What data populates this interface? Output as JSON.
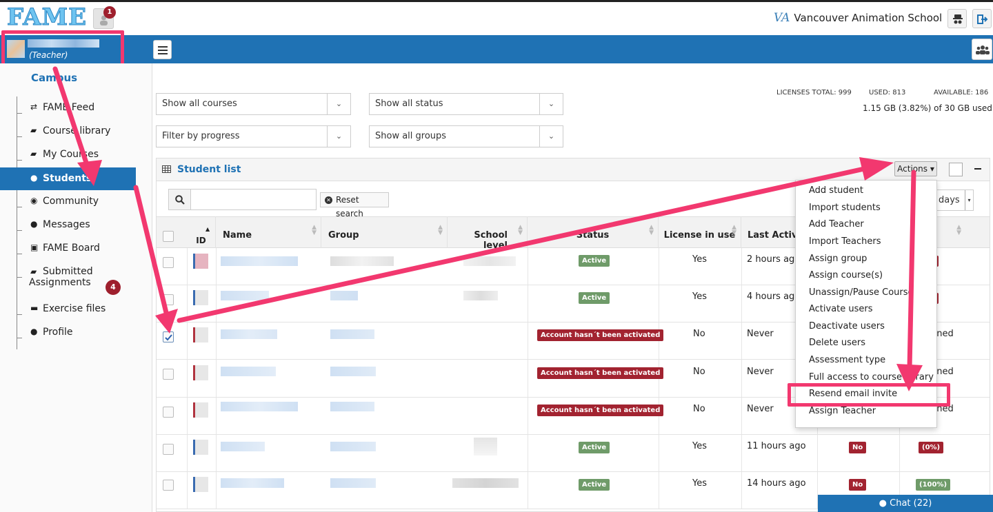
{
  "app": {
    "logo": "FAME",
    "notifications_count": "1",
    "school_name": "Vancouver Animation School",
    "school_logo": "VA"
  },
  "user": {
    "role": "(Teacher)"
  },
  "sidebar": {
    "section": "Campus",
    "items": [
      {
        "label": "FAME Feed",
        "icon": "retweet-icon"
      },
      {
        "label": "Course library",
        "icon": "book-icon"
      },
      {
        "label": "My Courses",
        "icon": "book-icon"
      },
      {
        "label": "Students",
        "icon": "users-icon",
        "active": true
      },
      {
        "label": "Community",
        "icon": "globe-icon"
      },
      {
        "label": "Messages",
        "icon": "comment-icon"
      },
      {
        "label": "FAME Board",
        "icon": "image-icon"
      },
      {
        "label": "Submitted",
        "label2": "Assignments",
        "icon": "book-icon",
        "badge": "4"
      },
      {
        "label": "Exercise files",
        "icon": "folder-open-icon"
      },
      {
        "label": "Profile",
        "icon": "user-icon"
      }
    ]
  },
  "filters": {
    "courses": "Show all courses",
    "status": "Show all status",
    "progress": "Filter by progress",
    "groups": "Show all groups"
  },
  "licenses": {
    "total": "LICENSES TOTAL: 999",
    "used": "USED: 813",
    "available": "AVAILABLE: 186",
    "storage": "1.15 GB (3.82%) of 30 GB used"
  },
  "panel": {
    "title": "Student list",
    "actions_label": "Actions",
    "reset_label": "Reset search",
    "days_label": "days"
  },
  "table": {
    "headers": {
      "id": "ID",
      "name": "Name",
      "group": "Group",
      "school_level": "School level",
      "status": "Status",
      "license": "License in use",
      "last_activity": "Last Activity"
    },
    "rows": [
      {
        "status": "Active",
        "license": "Yes",
        "last_activity": "2 hours ago",
        "extra": "",
        "checked": false
      },
      {
        "status": "Active",
        "license": "Yes",
        "last_activity": "4 hours ago",
        "extra": "",
        "checked": false
      },
      {
        "status": "Account hasn´t been activated",
        "license": "No",
        "last_activity": "Never",
        "extra": "gned",
        "checked": true
      },
      {
        "status": "Account hasn´t been activated",
        "license": "No",
        "last_activity": "Never",
        "extra": "gned",
        "checked": false
      },
      {
        "status": "Account hasn´t been activated",
        "license": "No",
        "last_activity": "Never",
        "extra": "gned",
        "checked": false
      },
      {
        "status": "Active",
        "license": "Yes",
        "last_activity": "11 hours ago",
        "col8": "No",
        "col9": "(0%)",
        "checked": false
      },
      {
        "status": "Active",
        "license": "Yes",
        "last_activity": "14 hours ago",
        "col8": "No",
        "col9": "(100%)",
        "checked": false
      }
    ]
  },
  "actions_menu": [
    "Add student",
    "Import students",
    "Add Teacher",
    "Import Teachers",
    "Assign group",
    "Assign course(s)",
    "Unassign/Pause Course",
    "Activate users",
    "Deactivate users",
    "Delete users",
    "Assessment type",
    "Full access to course library",
    "Resend email invite",
    "Assign Teacher"
  ],
  "chat": {
    "label": "Chat (22)"
  },
  "colors": {
    "primary": "#1f72b4",
    "highlight": "#f2386f",
    "active_badge": "#6f9b69",
    "danger_badge": "#a22330"
  }
}
